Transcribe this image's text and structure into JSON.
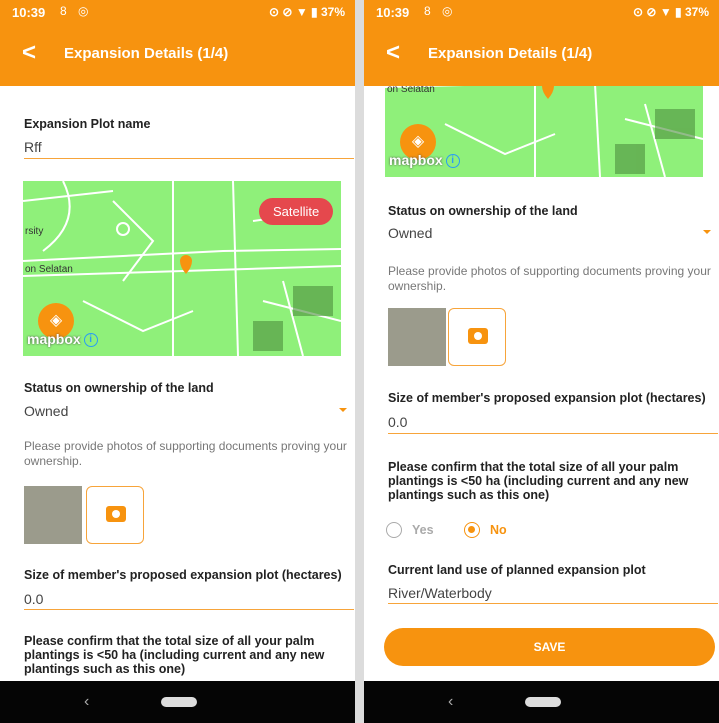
{
  "status_bar": {
    "time": "10:39",
    "misc_icons": "8 ◎",
    "right_icons": "⊙ ⊘ ▼ ▮ 37%"
  },
  "app_bar": {
    "back_glyph": "<",
    "title": "Expansion Details (1/4)"
  },
  "form": {
    "plot_name_label": "Expansion Plot name",
    "plot_name_value": "Rff",
    "map": {
      "satellite_label": "Satellite",
      "mapbox_label": "mapbox",
      "info_glyph": "i",
      "road_labels": [
        "rsity",
        "on Selatan"
      ],
      "layers_icon": "layers-icon",
      "pin_color": "#f7930f"
    },
    "ownership_label": "Status on ownership of the land",
    "ownership_value": "Owned",
    "photos_hint": "Please provide photos of supporting documents proving your ownership.",
    "size_label": "Size of member's proposed expansion plot (hectares)",
    "size_value": "0.0",
    "confirm_question": "Please confirm that the total size of all your palm plantings is <50 ha (including current and any new plantings such as this one)",
    "confirm_options": [
      "Yes",
      "No"
    ],
    "confirm_selected": "No",
    "land_use_label": "Current land use of planned expansion plot",
    "land_use_value": "River/Waterbody",
    "save_label": "SAVE"
  },
  "colors": {
    "accent": "#f7930f",
    "satellite_button": "#e5484d",
    "map_land": "#8ff07a",
    "nav_bar": "#050505"
  }
}
